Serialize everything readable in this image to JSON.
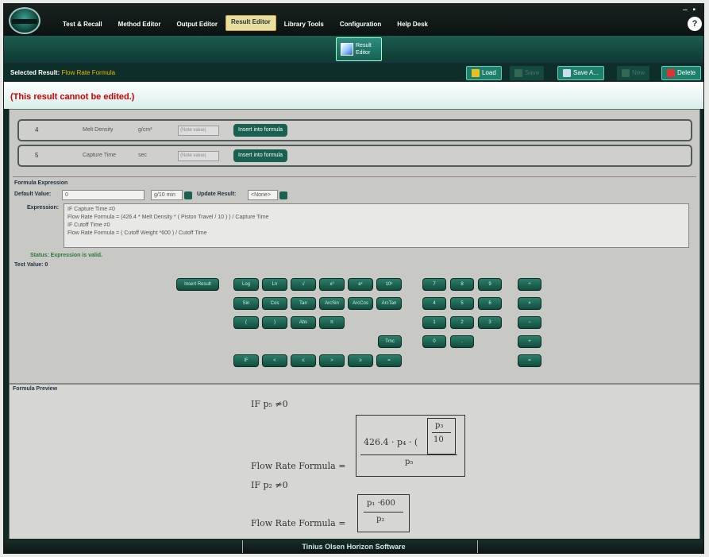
{
  "menu": [
    "Test & Recall",
    "Method Editor",
    "Output Editor",
    "Result Editor",
    "Library Tools",
    "Configuration",
    "Help Desk"
  ],
  "ribbon_button": {
    "line1": "Result",
    "line2": "Editor"
  },
  "help": "?",
  "selected": {
    "label": "Selected Result:",
    "value": "Flow Rate Formula"
  },
  "actions": {
    "load": "Load",
    "save": "Save",
    "save_as": "Save A...",
    "new": "New",
    "delete": "Delete"
  },
  "message": "(This result cannot be edited.)",
  "inputs": [
    {
      "num": "4",
      "name": "Melt Density",
      "unit": "g/cm³",
      "dd": "(Note value)",
      "btn": "Insert into formula"
    },
    {
      "num": "5",
      "name": "Capture Time",
      "unit": "sec",
      "dd": "(Note value)",
      "btn": "Insert into formula"
    }
  ],
  "expr": {
    "section": "Formula Expression",
    "default_label": "Default Value:",
    "default_value": "0",
    "unit_select": "g/10 min",
    "update_label": "Update Result:",
    "update_value": "<None>",
    "expression_label": "Expression:",
    "lines": [
      "IF Capture Time ≠0",
      "Flow Rate Formula = (426.4 * Melt Density * ( Piston Travel / 10 ) ) / Capture Time",
      "IF Cutoff Time ≠0",
      "Flow Rate Formula = ( Cutoff Weight *600 ) / Cutoff Time"
    ],
    "status": "Status: Expression is valid.",
    "test_value": "Test Value: 0"
  },
  "keypad": {
    "insert": "Insert Result",
    "fn_row1": [
      "Log",
      "Ln",
      "√",
      "x²",
      "eˣ",
      "10ˣ"
    ],
    "fn_row2": [
      "Sin",
      "Cos",
      "Tan",
      "ArcSin",
      "ArcCos",
      "ArcTan"
    ],
    "fn_row3": [
      "(",
      ")",
      "Abs",
      "π"
    ],
    "trnc": "Trnc",
    "cmp": [
      "IF",
      "<",
      "≤",
      ">",
      "≥",
      "="
    ],
    "num_row1": [
      "7",
      "8",
      "9"
    ],
    "num_row2": [
      "4",
      "5",
      "6"
    ],
    "num_row3": [
      "1",
      "2",
      "3"
    ],
    "num_row4": [
      "0",
      "."
    ],
    "ops": [
      "÷",
      "×",
      "−",
      "+",
      "="
    ]
  },
  "preview": {
    "section": "Formula Preview",
    "if1": "IF p₅ ≠0",
    "lhs1": "Flow Rate Formula =",
    "num1": "426.4 · p₄ · (",
    "frac_top": "p₃",
    "frac_bot": "10",
    "den1": "p₅",
    "if2": "IF p₂ ≠0",
    "lhs2": "Flow Rate Formula =",
    "num2": "p₁ ·600",
    "den2": "p₂"
  },
  "footer": "Tinius Olsen Horizon Software"
}
